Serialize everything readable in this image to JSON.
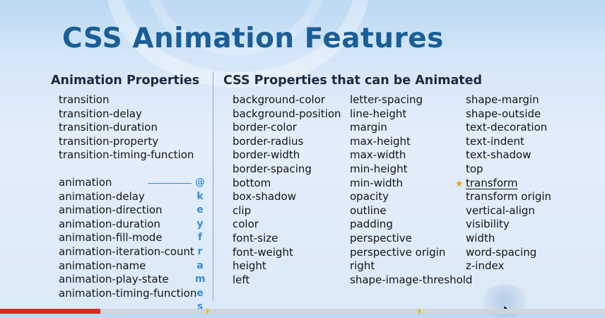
{
  "title": "CSS Animation Features",
  "left_heading": "Animation Properties",
  "right_heading": "CSS Properties that can be Animated",
  "transition_props": [
    "transition",
    "transition-delay",
    "transition-duration",
    "transition-property",
    "transition-timing-function"
  ],
  "animation_props": [
    "animation",
    "animation-delay",
    "animation-direction",
    "animation-duration",
    "animation-fill-mode",
    "animation-iteration-count",
    "animation-name",
    "animation-play-state",
    "animation-timing-function"
  ],
  "keyframes_letters": [
    "@",
    "k",
    "e",
    "y",
    "f",
    "r",
    "a",
    "m",
    "e",
    "s"
  ],
  "animatable_col1": [
    "background-color",
    "background-position",
    "border-color",
    "border-radius",
    "border-width",
    "border-spacing",
    "bottom",
    "box-shadow",
    "clip",
    "color",
    "font-size",
    "font-weight",
    "height",
    "left"
  ],
  "animatable_col2": [
    "letter-spacing",
    "line-height",
    "margin",
    "max-height",
    "max-width",
    "min-height",
    "min-width",
    "opacity",
    "outline",
    "padding",
    "perspective",
    "perspective origin",
    "right",
    "shape-image-threshold"
  ],
  "animatable_col3": [
    "shape-margin",
    "shape-outside",
    "text-decoration",
    "text-indent",
    "text-shadow",
    "top",
    "transform",
    "transform origin",
    "vertical-align",
    "visibility",
    "width",
    "word-spacing",
    "z-index"
  ],
  "highlighted_property": "transform",
  "colors": {
    "title": "#1a5e97",
    "keyframes": "#3a8dd0",
    "star": "#e8a21b",
    "progress": "#d52a1c"
  }
}
